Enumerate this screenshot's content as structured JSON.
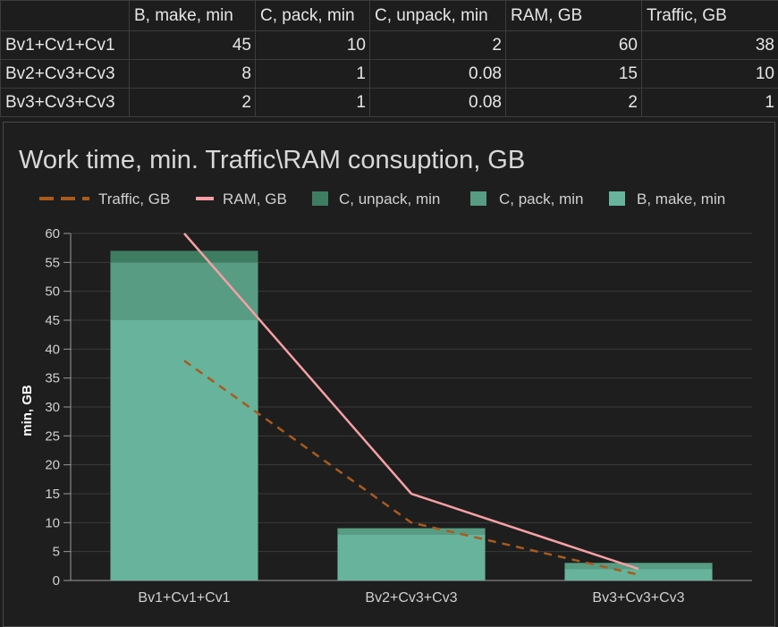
{
  "table": {
    "headers": [
      "",
      "B, make, min",
      "C, pack, min",
      "C, unpack, min",
      "RAM, GB",
      "Traffic, GB"
    ],
    "rows": [
      [
        "Bv1+Cv1+Cv1",
        "45",
        "10",
        "2",
        "60",
        "38"
      ],
      [
        "Bv2+Cv3+Cv3",
        "8",
        "1",
        "0.08",
        "15",
        "10"
      ],
      [
        "Bv3+Cv3+Cv3",
        "2",
        "1",
        "0.08",
        "2",
        "1"
      ]
    ]
  },
  "chart_data": {
    "type": "bar",
    "title": "Work time, min. Traffic\\RAM consuption, GB",
    "ylabel": "min, GB",
    "xlabel": "",
    "categories": [
      "Bv1+Cv1+Cv1",
      "Bv2+Cv3+Cv3",
      "Bv3+Cv3+Cv3"
    ],
    "ylim": [
      0,
      60
    ],
    "yticks": [
      0,
      5,
      10,
      15,
      20,
      25,
      30,
      35,
      40,
      45,
      50,
      55,
      60
    ],
    "grid": true,
    "legend_position": "top",
    "stacked_series": [
      {
        "name": "B, make, min",
        "values": [
          45,
          8,
          2
        ],
        "color": "#67b39c"
      },
      {
        "name": "C, pack, min",
        "values": [
          10,
          1,
          1
        ],
        "color": "#589d83"
      },
      {
        "name": "C, unpack, min",
        "values": [
          2,
          0.08,
          0.08
        ],
        "color": "#3f7d63"
      }
    ],
    "line_series": [
      {
        "name": "Traffic, GB",
        "values": [
          38,
          10,
          1
        ],
        "color": "#a85b1f",
        "dashed": true
      },
      {
        "name": "RAM, GB",
        "values": [
          60,
          15,
          2
        ],
        "color": "#f4a0a5",
        "dashed": false
      }
    ],
    "legend_order": [
      "Traffic, GB",
      "RAM, GB",
      "C, unpack, min",
      "C, pack, min",
      "B, make, min"
    ]
  }
}
